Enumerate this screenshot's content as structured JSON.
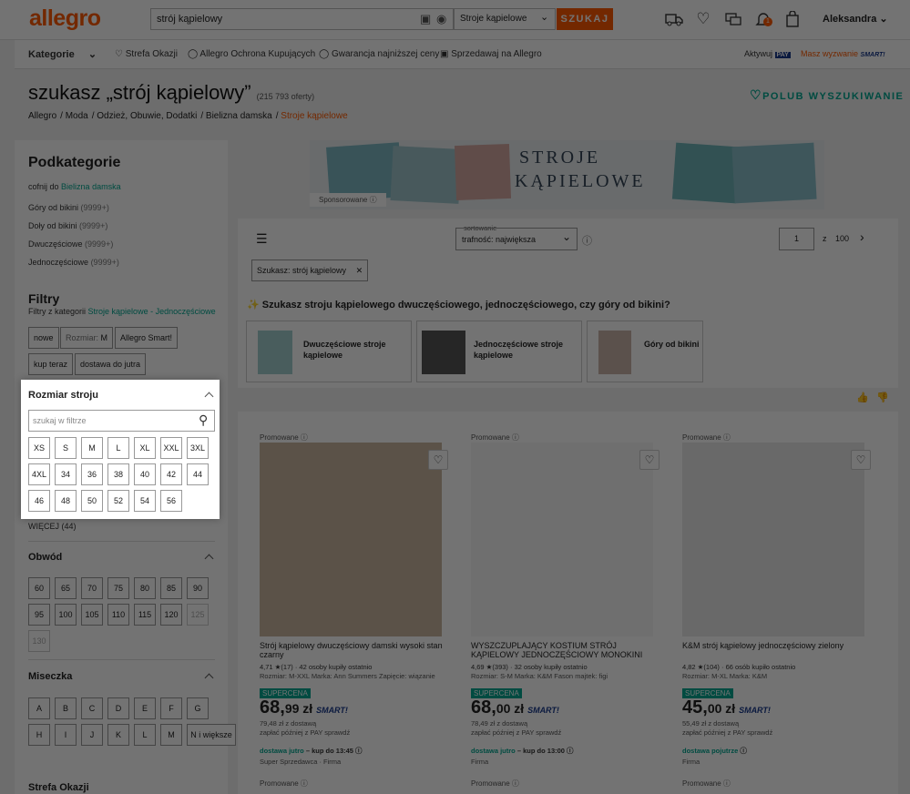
{
  "header": {
    "logo": "allegro",
    "search_value": "strój kąpielowy",
    "category_select": "Stroje kąpielowe",
    "search_button": "SZUKAJ",
    "notification_count": "1",
    "user_name": "Aleksandra"
  },
  "nav": {
    "categories": "Kategorie",
    "items": [
      "Strefa Okazji",
      "Allegro Ochrona Kupujących",
      "Gwarancja najniższej ceny",
      "Sprzedawaj na Allegro"
    ],
    "active_label": "Aktywuj",
    "pay": "PAY",
    "challenge": "Masz wyzwanie",
    "smart": "SMART!"
  },
  "page": {
    "title": "szukasz „strój kąpielowy”",
    "offer_count": "(215 793 oferty)",
    "like_search": "POLUB WYSZUKIWANIE",
    "breadcrumb": [
      "Allegro",
      "Moda",
      "Odzież, Obuwie, Dodatki",
      "Bielizna damska",
      "Stroje kąpielowe"
    ]
  },
  "sidebar": {
    "subcat_title": "Podkategorie",
    "back_prefix": "cofnij do",
    "back_link": "Bielizna damska",
    "subcats": [
      {
        "name": "Góry od bikini",
        "count": "(9999+)"
      },
      {
        "name": "Doły od bikini",
        "count": "(9999+)"
      },
      {
        "name": "Dwuczęściowe",
        "count": "(9999+)"
      },
      {
        "name": "Jednoczęściowe",
        "count": "(9999+)"
      }
    ],
    "filters_title": "Filtry",
    "filters_from": "Filtry z kategorii",
    "filters_from_link": "Stroje kąpielowe - Jednoczęściowe",
    "chips": [
      "nowe",
      "Rozmiar:",
      "M",
      "Allegro Smart!",
      "kup teraz",
      "dostawa do jutra"
    ],
    "size_title": "Rozmiar stroju",
    "size_search_placeholder": "szukaj w filtrze",
    "sizes": [
      "XS",
      "S",
      "M",
      "L",
      "XL",
      "XXL",
      "3XL",
      "4XL",
      "34",
      "36",
      "38",
      "40",
      "42",
      "44",
      "46",
      "48",
      "50",
      "52",
      "54",
      "56"
    ],
    "more": "WIĘCEJ (44)",
    "circ_title": "Obwód",
    "circ": [
      "60",
      "65",
      "70",
      "75",
      "80",
      "85",
      "90",
      "95",
      "100",
      "105",
      "110",
      "115",
      "120",
      "125",
      "130"
    ],
    "cup_title": "Miseczka",
    "cups": [
      "A",
      "B",
      "C",
      "D",
      "E",
      "F",
      "G",
      "H",
      "I",
      "J",
      "K",
      "L",
      "M",
      "N i większe"
    ],
    "next_title": "Strefa Okazji"
  },
  "banner": {
    "line1": "Stroje",
    "line2": "Kąpielowe",
    "sponsored": "Sponsorowane"
  },
  "controls": {
    "sort_label": "sortowanie",
    "sort_value": "trafność: największa",
    "page": "1",
    "of": "z",
    "total_pages": "100",
    "filter_tag": "Szukasz: strój kąpielowy"
  },
  "suggest": {
    "title": "Szukasz stroju kąpielowego dwuczęściowego, jednoczęściowego, czy góry od bikini?",
    "cards": [
      "Dwuczęściowe stroje kąpielowe",
      "Jednoczęściowe stroje kąpielowe",
      "Góry od bikini"
    ]
  },
  "products": [
    {
      "promo": "Promowane",
      "name": "Strój kąpielowy dwuczęściowy damski wysoki stan czarny",
      "rating": "4,71",
      "reviews": "(17)",
      "bought": "42 osoby",
      "bought_suffix": "kupiły ostatnio",
      "attrs": "Rozmiar: M-XXL   Marka: Ann Summers   Zapięcie: wiązanie",
      "badge": "SUPERCENA",
      "price_int": "68,",
      "price_dec": "99",
      "currency": "zł",
      "with_delivery": "79,48 zł z dostawą",
      "pay_later": "zapłać później z PAY sprawdź",
      "delivery": "dostawa jutro",
      "delivery_time": "– kup do 13:45",
      "seller": "Super Sprzedawca · Firma",
      "img_color": "#cbb79f"
    },
    {
      "promo": "Promowane",
      "name": "WYSZCZUPLAJĄCY KOSTIUM STRÓJ KĄPIELOWY JEDNOCZĘŚCIOWY MONOKINI",
      "rating": "4,69",
      "reviews": "(393)",
      "bought": "32 osoby",
      "bought_suffix": "kupiły ostatnio",
      "attrs": "Rozmiar: S-M   Marka: K&M   Fason majtek: figi",
      "badge": "SUPERCENA",
      "price_int": "68,",
      "price_dec": "00",
      "currency": "zł",
      "with_delivery": "78,49 zł z dostawą",
      "pay_later": "zapłać później z PAY sprawdź",
      "delivery": "dostawa jutro",
      "delivery_time": "– kup do 13:00",
      "seller": "Firma",
      "img_color": "#f6f6f6"
    },
    {
      "promo": "Promowane",
      "name": "K&M strój kąpielowy jednoczęściowy zielony",
      "rating": "4,82",
      "reviews": "(104)",
      "bought": "66 osób",
      "bought_suffix": "kupiło ostatnio",
      "attrs": "Rozmiar: M-XL   Marka: K&M",
      "badge": "SUPERCENA",
      "price_int": "45,",
      "price_dec": "00",
      "currency": "zł",
      "with_delivery": "55,49 zł z dostawą",
      "pay_later": "zapłać później z PAY sprawdź",
      "delivery": "dostawa pojutrze",
      "delivery_time": "",
      "seller": "Firma",
      "img_color": "#e8e8e8"
    }
  ],
  "colors": {
    "brand": "#ff5a00",
    "teal": "#00a790"
  }
}
